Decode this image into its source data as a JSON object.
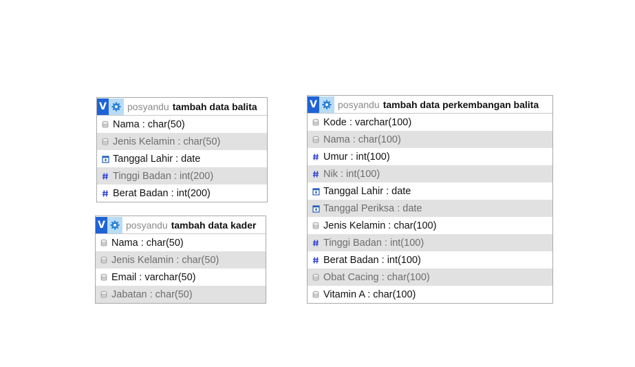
{
  "tables": [
    {
      "id": "card-balita",
      "database": "posyandu",
      "name": "tambah data balita",
      "columns": [
        {
          "label": "Nama : char(50)",
          "type": "char"
        },
        {
          "label": "Jenis Kelamin : char(50)",
          "type": "char"
        },
        {
          "label": "Tanggal Lahir : date",
          "type": "date"
        },
        {
          "label": "Tinggi Badan : int(200)",
          "type": "int"
        },
        {
          "label": "Berat Badan : int(200)",
          "type": "int"
        }
      ]
    },
    {
      "id": "card-kader",
      "database": "posyandu",
      "name": "tambah data kader",
      "columns": [
        {
          "label": "Nama : char(50)",
          "type": "char"
        },
        {
          "label": "Jenis Kelamin : char(50)",
          "type": "char"
        },
        {
          "label": "Email : varchar(50)",
          "type": "char"
        },
        {
          "label": "Jabatan : char(50)",
          "type": "char"
        }
      ]
    },
    {
      "id": "card-perkembangan",
      "database": "posyandu",
      "name": "tambah data perkembangan balita",
      "columns": [
        {
          "label": "Kode : varchar(100)",
          "type": "char"
        },
        {
          "label": "Nama : char(100)",
          "type": "char"
        },
        {
          "label": "Umur : int(100)",
          "type": "int"
        },
        {
          "label": "Nik : int(100)",
          "type": "int"
        },
        {
          "label": "Tanggal Lahir : date",
          "type": "date"
        },
        {
          "label": "Tanggal Periksa : date",
          "type": "date"
        },
        {
          "label": "Jenis Kelamin : char(100)",
          "type": "char"
        },
        {
          "label": "Tinggi Badan : int(100)",
          "type": "int"
        },
        {
          "label": "Berat Badan : int(100)",
          "type": "int"
        },
        {
          "label": "Obat Cacing : char(100)",
          "type": "char"
        },
        {
          "label": "Vitamin A : char(100)",
          "type": "char"
        }
      ]
    }
  ],
  "header": {
    "v_label": "V"
  },
  "colors": {
    "v_badge": "#1e63d6",
    "gear_bg": "#b9dcf6",
    "gear": "#2a7fd4",
    "int_icon": "#2b3fd6",
    "date_icon": "#1f5fb8",
    "char_icon": "#9a9a9a",
    "alt_row": "#e1e1e1"
  },
  "icons": {
    "header_toggle": "v-icon",
    "header_options": "gear-icon",
    "char": "text-column-icon",
    "int": "numeric-column-icon",
    "date": "date-column-icon"
  }
}
